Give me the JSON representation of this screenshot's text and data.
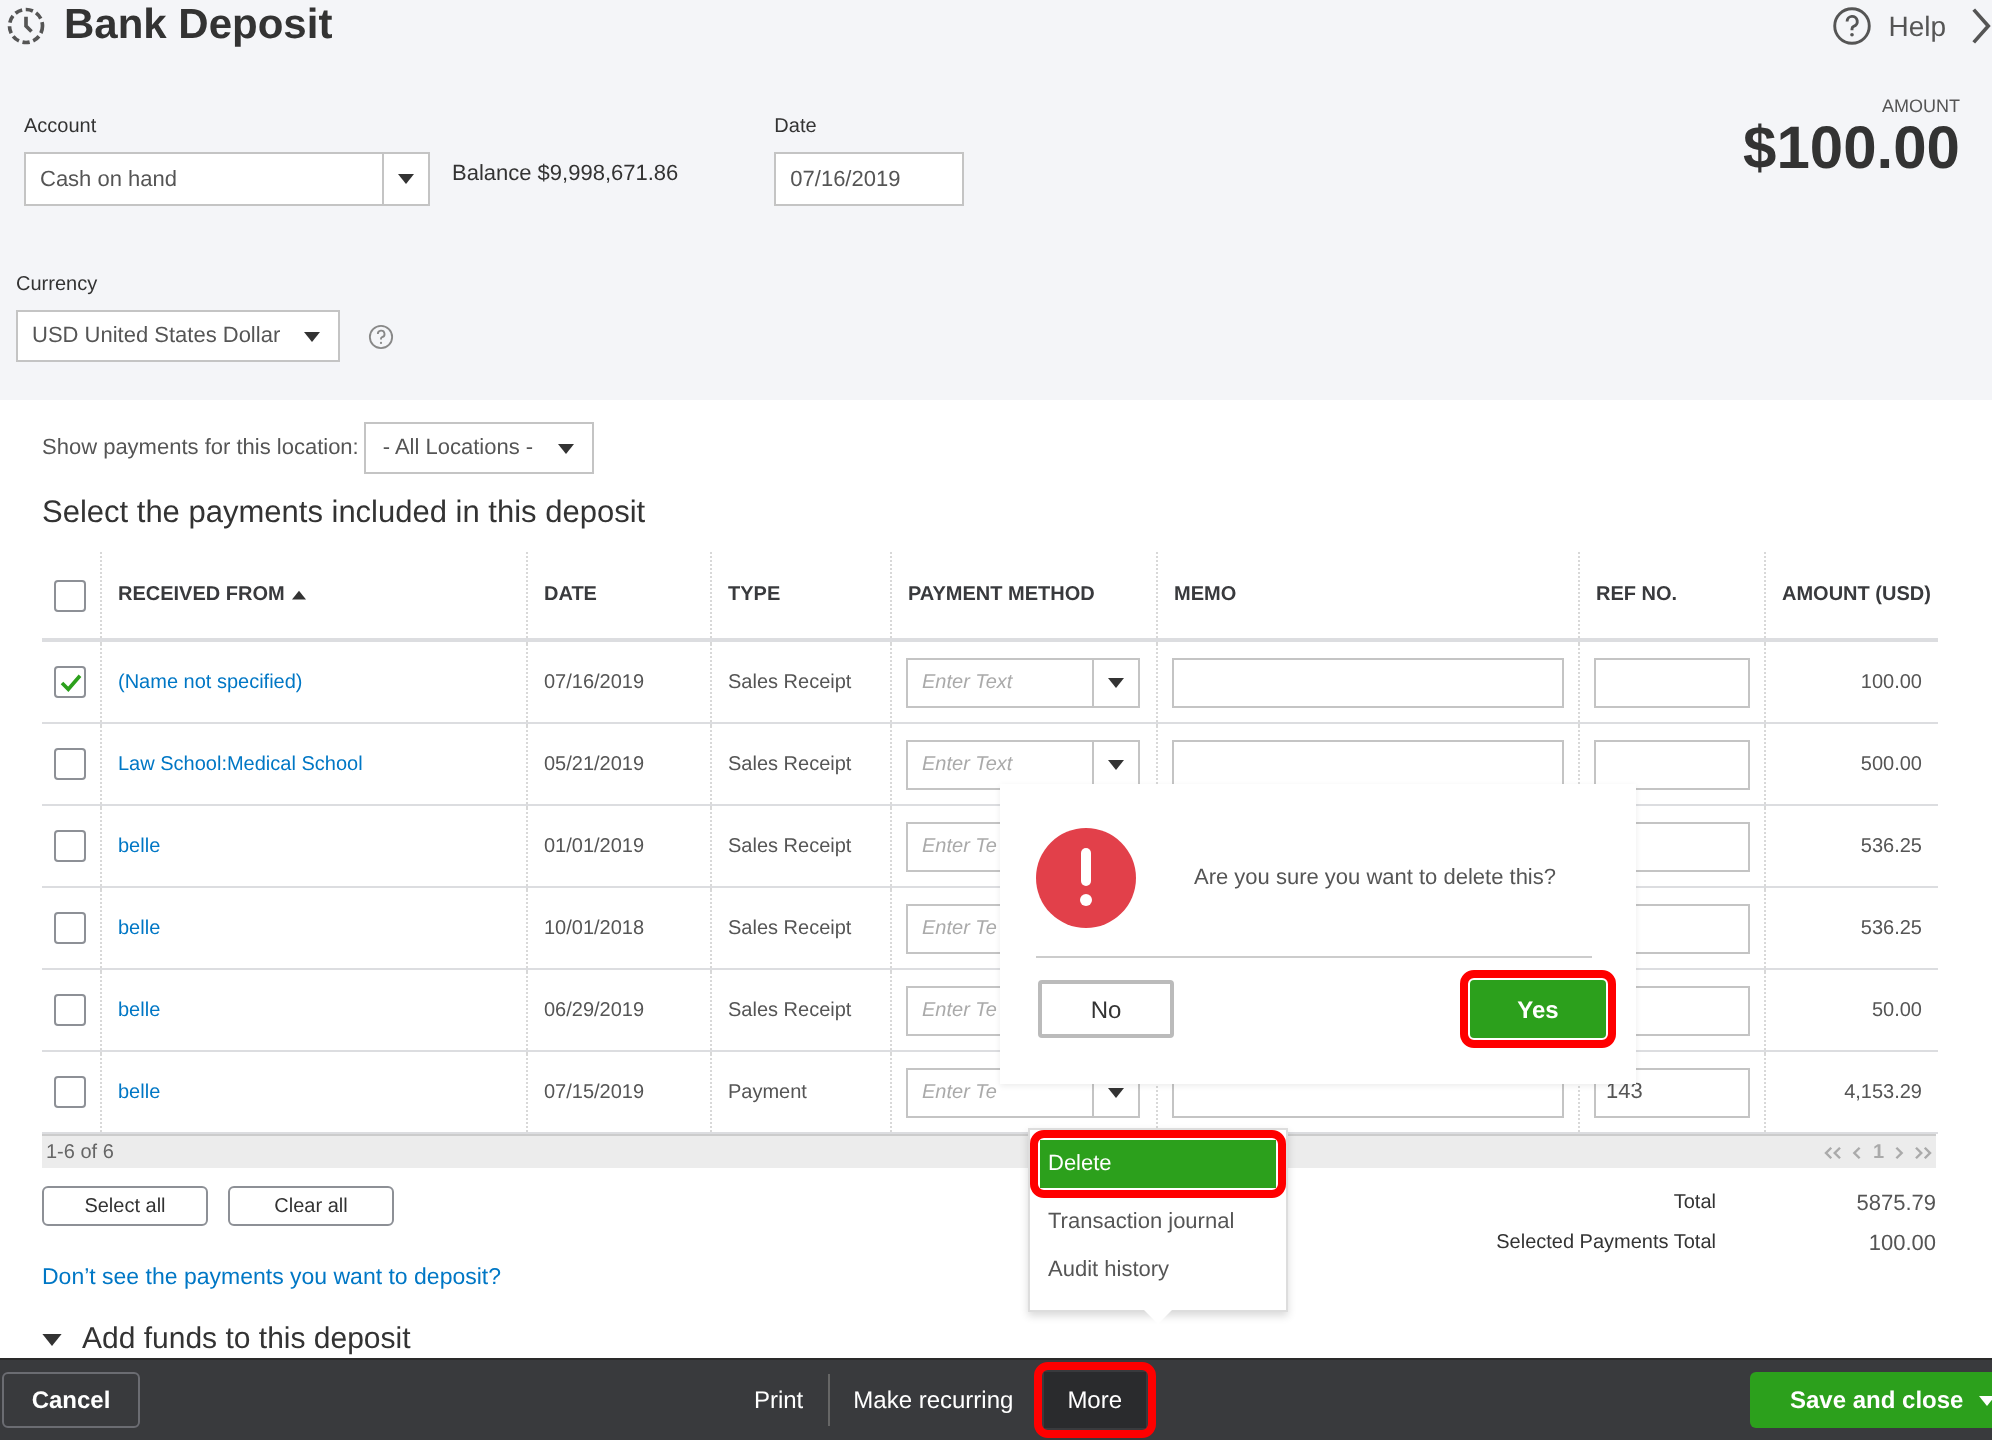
{
  "header": {
    "title": "Bank Deposit",
    "help": "Help"
  },
  "account": {
    "label": "Account",
    "value": "Cash on hand",
    "balance": "Balance $9,998,671.86"
  },
  "date": {
    "label": "Date",
    "value": "07/16/2019"
  },
  "amount": {
    "label": "AMOUNT",
    "value": "$100.00"
  },
  "currency": {
    "label": "Currency",
    "value": "USD United States Dollar"
  },
  "location_filter": {
    "label": "Show payments for this location:",
    "value": "- All Locations -"
  },
  "section_title": "Select the payments included in this deposit",
  "table": {
    "all_checked": false,
    "columns": [
      "RECEIVED FROM",
      "DATE",
      "TYPE",
      "PAYMENT METHOD",
      "MEMO",
      "REF NO.",
      "AMOUNT (USD)"
    ],
    "rows": [
      {
        "checked": true,
        "received_from": "(Name not specified)",
        "date": "07/16/2019",
        "type": "Sales Receipt",
        "payment_method": "Enter Text",
        "memo_field": true,
        "ref": "",
        "amount": "100.00"
      },
      {
        "checked": false,
        "received_from": "Law School:Medical School",
        "date": "05/21/2019",
        "type": "Sales Receipt",
        "payment_method": "Enter Text",
        "memo_field": true,
        "ref": "",
        "amount": "500.00"
      },
      {
        "checked": false,
        "received_from": "belle",
        "date": "01/01/2019",
        "type": "Sales Receipt",
        "payment_method": "Enter Te",
        "ref": "",
        "amount": "536.25"
      },
      {
        "checked": false,
        "received_from": "belle",
        "date": "10/01/2018",
        "type": "Sales Receipt",
        "payment_method": "Enter Te",
        "ref": "",
        "amount": "536.25"
      },
      {
        "checked": false,
        "received_from": "belle",
        "date": "06/29/2019",
        "type": "Sales Receipt",
        "payment_method": "Enter Te",
        "ref": "",
        "amount": "50.00"
      },
      {
        "checked": false,
        "received_from": "belle",
        "date": "07/15/2019",
        "type": "Payment",
        "payment_method": "Enter Te",
        "memo_field": true,
        "ref": "143",
        "amount": "4,153.29"
      }
    ],
    "range": "1-6 of 6",
    "page": "1"
  },
  "buttons": [
    "Select all",
    "Clear all"
  ],
  "totals": [
    {
      "label": "Total",
      "value": "5875.79"
    },
    {
      "label": "Selected Payments Total",
      "value": "100.00"
    }
  ],
  "link": "Don’t see the payments you want to deposit?",
  "add_funds": "Add funds to this deposit",
  "footer": {
    "cancel": "Cancel",
    "print": "Print",
    "make_recurring": "Make recurring",
    "more": "More",
    "more_highlighted": true,
    "save": "Save and close"
  },
  "menu": {
    "items": [
      {
        "label": "Delete",
        "selected": true,
        "highlighted": true
      },
      {
        "label": "Transaction journal",
        "selected": false,
        "highlighted": false
      },
      {
        "label": "Audit history",
        "selected": false,
        "highlighted": false
      }
    ]
  },
  "dialog": {
    "message": "Are you sure you want to delete this?",
    "no": "No",
    "yes": "Yes",
    "yes_highlighted": true
  }
}
